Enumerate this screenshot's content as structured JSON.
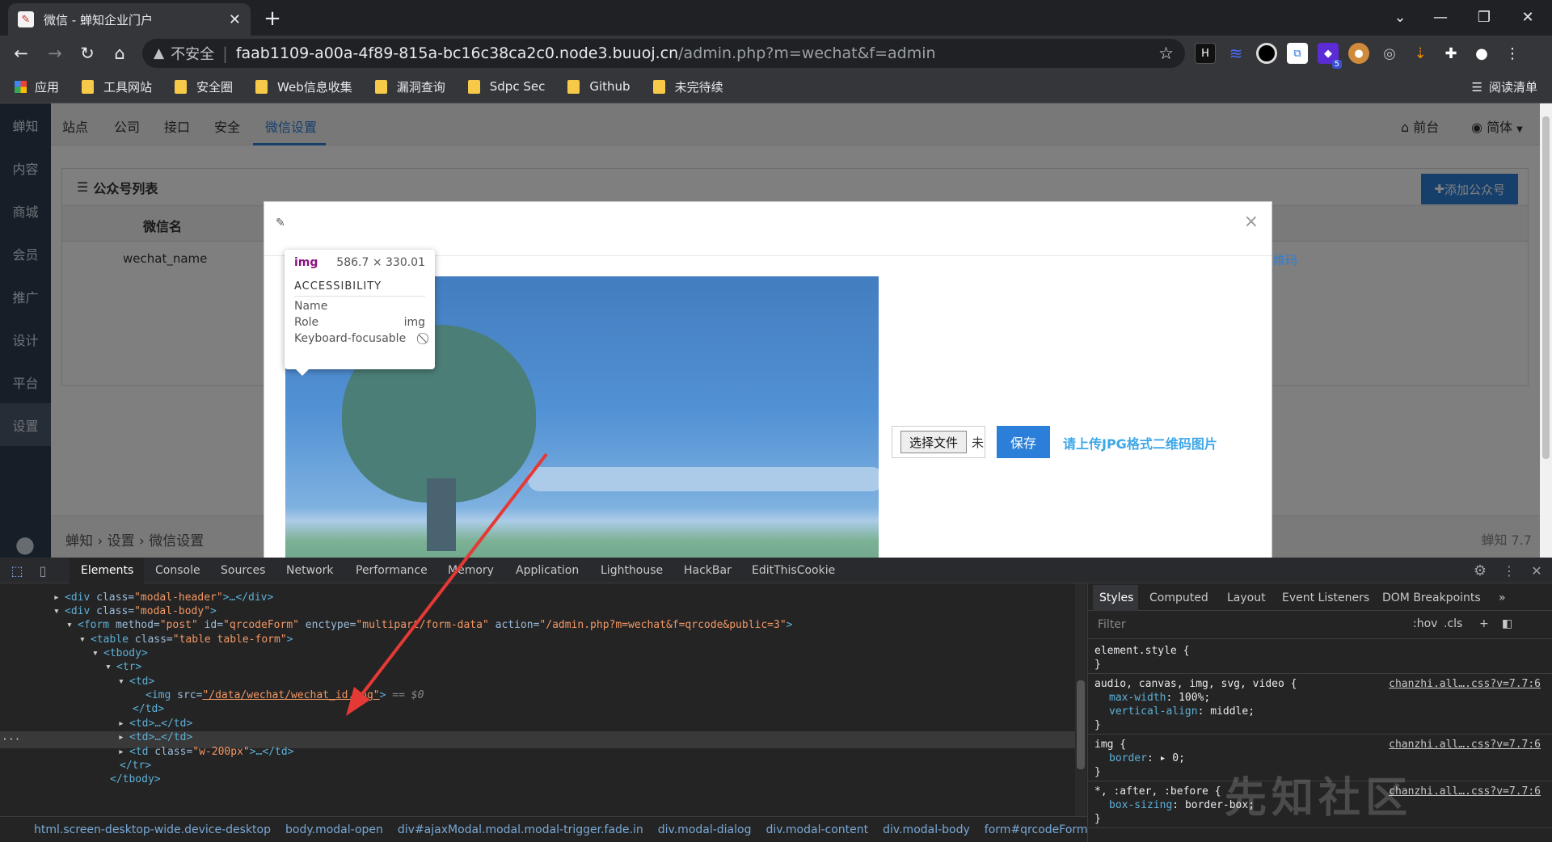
{
  "browser": {
    "tab_title": "微信 - 蝉知企业门户",
    "address": {
      "insecure_label": "不安全",
      "host": "faab1109-a00a-4f89-815a-bc16c38ca2c0.node3.buuoj.cn",
      "path": "/admin.php?m=wechat&f=admin"
    },
    "bookmarks": [
      "应用",
      "工具网站",
      "安全圈",
      "Web信息收集",
      "漏洞查询",
      "Sdpc Sec",
      "Github",
      "未完待续"
    ],
    "reading_list": "阅读清单",
    "extension_badge": "5"
  },
  "app": {
    "sidebar": [
      "蝉知",
      "内容",
      "商城",
      "会员",
      "推广",
      "设计",
      "平台",
      "设置"
    ],
    "topnav": [
      "站点",
      "公司",
      "接口",
      "安全",
      "微信设置"
    ],
    "topnav_right": [
      "前台",
      "简体"
    ],
    "panel_title": "公众号列表",
    "add_button": "添加公众号",
    "table_header": "微信名",
    "table_cell": "wechat_name",
    "right_cell": "维码",
    "breadcrumb": [
      "蝉知",
      "设置",
      "微信设置"
    ],
    "version": "蝉知 7.7"
  },
  "modal": {
    "close": "×",
    "choose_file": "选择文件",
    "choose_suffix": "未",
    "save": "保存",
    "hint": "请上传JPG格式二维码图片"
  },
  "tooltip": {
    "tag": "img",
    "size": "586.7 × 330.01",
    "section": "ACCESSIBILITY",
    "name_label": "Name",
    "role_label": "Role",
    "role_value": "img",
    "focus_label": "Keyboard-focusable"
  },
  "devtools": {
    "tabs": [
      "Elements",
      "Console",
      "Sources",
      "Network",
      "Performance",
      "Memory",
      "Application",
      "Lighthouse",
      "HackBar",
      "EditThisCookie"
    ],
    "code": [
      {
        "open": "<div",
        "attrs": [
          [
            "class",
            "\"modal-header\""
          ]
        ],
        "rest": ">…</div>"
      },
      {
        "open": "<div",
        "attrs": [
          [
            "class",
            "\"modal-body\""
          ]
        ],
        "rest": ">"
      },
      {
        "open": "<form",
        "attrs": [
          [
            "method",
            "\"post\""
          ],
          [
            "id",
            "\"qrcodeForm\""
          ],
          [
            "enctype",
            "\"multipart/form-data\""
          ],
          [
            "action",
            "\"/admin.php?m=wechat&f=qrcode&public=3\""
          ]
        ],
        "rest": ">"
      },
      {
        "open": "<table",
        "attrs": [
          [
            "class",
            "\"table table-form\""
          ]
        ],
        "rest": ">"
      },
      {
        "open": "<tbody",
        "attrs": [],
        "rest": ">"
      },
      {
        "open": "<tr",
        "attrs": [],
        "rest": ">"
      },
      {
        "open": "<td",
        "attrs": [],
        "rest": ">"
      },
      {
        "open": "<img",
        "attrs": [
          [
            "src",
            "\"/data/wechat/wechat_id.jpg\""
          ]
        ],
        "rest": "> == $0"
      },
      {
        "open": "</td",
        "attrs": [],
        "rest": ">"
      },
      {
        "open": "<td",
        "attrs": [],
        "rest": ">…</td>"
      },
      {
        "open": "<td",
        "attrs": [],
        "rest": ">…</td>"
      },
      {
        "open": "<td",
        "attrs": [
          [
            "class",
            "\"w-200px\""
          ]
        ],
        "rest": ">…</td>"
      },
      {
        "open": "</tr",
        "attrs": [],
        "rest": ">"
      },
      {
        "open": "</tbody",
        "attrs": [],
        "rest": ">"
      }
    ],
    "crumbs": [
      "html.screen-desktop-wide.device-desktop",
      "body.modal-open",
      "div#ajaxModal.modal.modal-trigger.fade.in",
      "div.modal-dialog",
      "div.modal-content",
      "div.modal-body",
      "form#qrcodeForm",
      "t"
    ],
    "styles_tabs": [
      "Styles",
      "Computed",
      "Layout",
      "Event Listeners",
      "DOM Breakpoints"
    ],
    "filter_placeholder": "Filter",
    "hov": ":hov",
    "cls": ".cls",
    "rules": [
      {
        "selector": "element.style {",
        "props": [],
        "source": ""
      },
      {
        "selector": "audio, canvas, img, svg, video {",
        "props": [
          [
            "max-width",
            "100%;"
          ],
          [
            "vertical-align",
            "middle;"
          ]
        ],
        "source": "chanzhi.all….css?v=7.7:6"
      },
      {
        "selector": "img {",
        "props": [
          [
            "border",
            "▸ 0;"
          ]
        ],
        "source": "chanzhi.all….css?v=7.7:6"
      },
      {
        "selector": "*, :after, :before {",
        "props": [
          [
            "box-sizing",
            "border-box;"
          ]
        ],
        "source": "chanzhi.all….css?v=7.7:6"
      }
    ]
  },
  "watermark": "先知社区",
  "colors": {
    "accent": "#2c7fd8",
    "sidebar": "#2c3e50",
    "arrow": "#e53935"
  }
}
